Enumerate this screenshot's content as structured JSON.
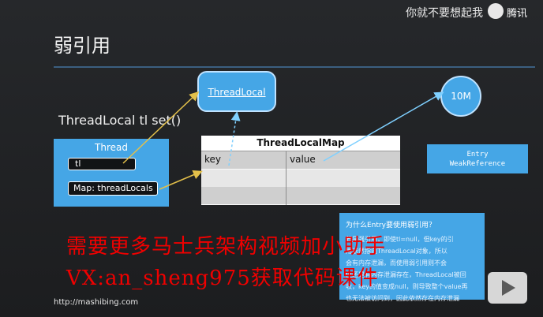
{
  "watermark": {
    "caption": "你就不要想起我",
    "brand": "腾讯",
    "logo_icon": "player-logo-icon"
  },
  "slide": {
    "title": "弱引用",
    "code_call": "ThreadLocal tl set()",
    "thread": {
      "title": "Thread",
      "tl_field": "tl",
      "map_field": "Map: threadLocals"
    },
    "threadlocal_node": "ThreadLocal",
    "memory_node": "10M",
    "map": {
      "title": "ThreadLocalMap",
      "columns": [
        "key",
        "value"
      ],
      "rows": [
        [
          "key",
          "value"
        ],
        [
          "",
          ""
        ],
        [
          "",
          ""
        ]
      ]
    },
    "entry": {
      "line1": "Entry",
      "line2": "WeakReference"
    },
    "note": {
      "question": "为什么Entry要使用弱引用？",
      "lines": [
        "若是强引用，即使tl=null，但key的引",
        "用依然指向ThreadLocal对象，所以",
        "会有内存泄漏，而使用弱引用则不会",
        "但还是有内存泄漏存在，ThreadLocal被回",
        "收，key的值变成null，则导致整个value再",
        "也无法被访问到，因此依然存在内存泄漏"
      ]
    }
  },
  "overlay": {
    "line1": "需要更多马士兵架构视频加小助手",
    "line2": "VX:an_sheng975获取代码课件"
  },
  "footer": {
    "url": "http://mashibing.com"
  },
  "colors": {
    "accent_blue": "#45a6e6",
    "arrow_yellow": "#e3c04a",
    "overlay_red": "#f00000"
  }
}
